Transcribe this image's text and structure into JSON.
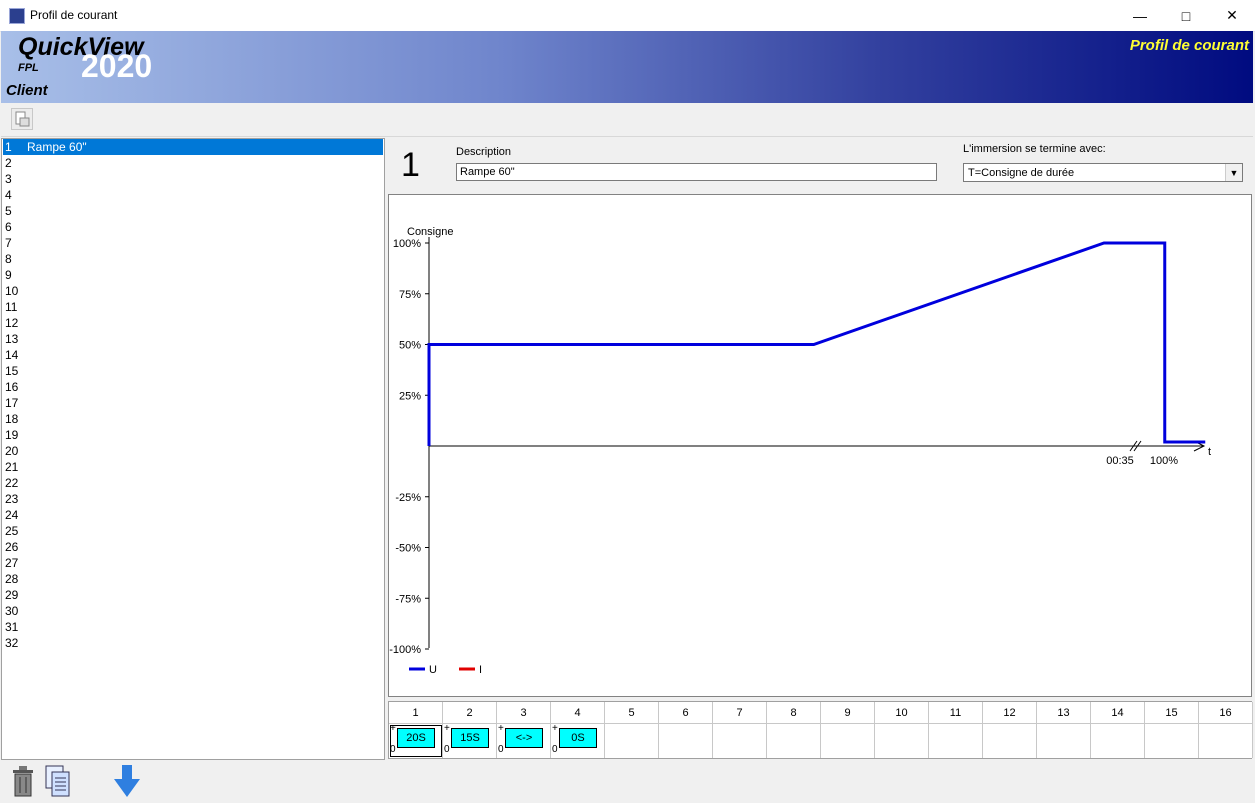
{
  "window": {
    "title": "Profil de courant"
  },
  "banner": {
    "brand": "QuickView",
    "year": "2020",
    "sub": "FPL",
    "client": "Client",
    "right_title": "Profil de courant"
  },
  "profiles": [
    {
      "n": "1",
      "label": "Rampe 60\""
    },
    {
      "n": "2",
      "label": ""
    },
    {
      "n": "3",
      "label": ""
    },
    {
      "n": "4",
      "label": ""
    },
    {
      "n": "5",
      "label": ""
    },
    {
      "n": "6",
      "label": ""
    },
    {
      "n": "7",
      "label": ""
    },
    {
      "n": "8",
      "label": ""
    },
    {
      "n": "9",
      "label": ""
    },
    {
      "n": "10",
      "label": ""
    },
    {
      "n": "11",
      "label": ""
    },
    {
      "n": "12",
      "label": ""
    },
    {
      "n": "13",
      "label": ""
    },
    {
      "n": "14",
      "label": ""
    },
    {
      "n": "15",
      "label": ""
    },
    {
      "n": "16",
      "label": ""
    },
    {
      "n": "17",
      "label": ""
    },
    {
      "n": "18",
      "label": ""
    },
    {
      "n": "19",
      "label": ""
    },
    {
      "n": "20",
      "label": ""
    },
    {
      "n": "21",
      "label": ""
    },
    {
      "n": "22",
      "label": ""
    },
    {
      "n": "23",
      "label": ""
    },
    {
      "n": "24",
      "label": ""
    },
    {
      "n": "25",
      "label": ""
    },
    {
      "n": "26",
      "label": ""
    },
    {
      "n": "27",
      "label": ""
    },
    {
      "n": "28",
      "label": ""
    },
    {
      "n": "29",
      "label": ""
    },
    {
      "n": "30",
      "label": ""
    },
    {
      "n": "31",
      "label": ""
    },
    {
      "n": "32",
      "label": ""
    }
  ],
  "selected_index": 0,
  "detail": {
    "number": "1",
    "description_label": "Description",
    "description_value": "Rampe 60\"",
    "end_label": "L'immersion se termine avec:",
    "end_value": "T=Consigne de durée"
  },
  "chart_data": {
    "type": "line",
    "ylabel": "Consigne",
    "xlabel": "t",
    "yticks": [
      "100%",
      "75%",
      "50%",
      "25%",
      "-25%",
      "-50%",
      "-75%",
      "-100%"
    ],
    "ylim": [
      -100,
      100
    ],
    "x_tick_labels": [
      "00:35",
      "100%"
    ],
    "series": [
      {
        "name": "U",
        "color": "#0000dd",
        "points": [
          [
            0,
            0
          ],
          [
            0,
            50
          ],
          [
            0.57,
            50
          ],
          [
            1.0,
            100
          ],
          [
            1.09,
            100
          ],
          [
            1.09,
            2
          ],
          [
            1.15,
            2
          ]
        ]
      },
      {
        "name": "I",
        "color": "#e00000",
        "points": []
      }
    ],
    "legend": "bottom-left"
  },
  "steps": {
    "columns": [
      "1",
      "2",
      "3",
      "4",
      "5",
      "6",
      "7",
      "8",
      "9",
      "10",
      "11",
      "12",
      "13",
      "14",
      "15",
      "16"
    ],
    "cells": [
      {
        "value": "20S",
        "plus": "+",
        "zero": "0"
      },
      {
        "value": "15S",
        "plus": "+",
        "zero": "0"
      },
      {
        "value": "<->",
        "plus": "+",
        "zero": "0"
      },
      {
        "value": "0S",
        "plus": "+",
        "zero": "0"
      }
    ]
  }
}
